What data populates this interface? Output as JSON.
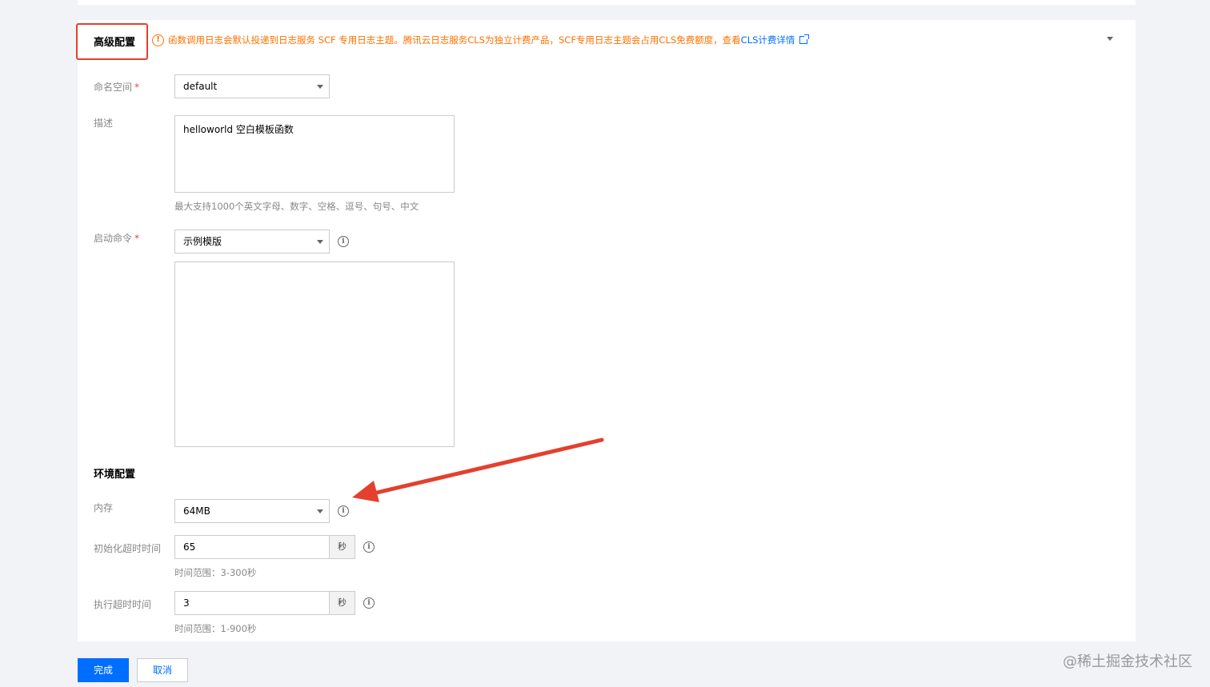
{
  "advanced": {
    "title": "高级配置",
    "notice_icon": "!",
    "notice_text": "函数调用日志会默认投递到日志服务 SCF 专用日志主题。腾讯云日志服务CLS为独立计费产品，SCF专用日志主题会占用CLS免费额度，查看",
    "notice_link": "CLS计费详情"
  },
  "namespace": {
    "label": "命名空间",
    "required": "*",
    "value": "default"
  },
  "description": {
    "label": "描述",
    "value": "helloworld 空白模板函数",
    "hint": "最大支持1000个英文字母、数字、空格、逗号、句号、中文"
  },
  "startup": {
    "label": "启动命令",
    "required": "*",
    "value": "示例模版",
    "script": ""
  },
  "env": {
    "title": "环境配置",
    "memory": {
      "label": "内存",
      "value": "64MB"
    },
    "init_timeout": {
      "label": "初始化超时时间",
      "value": "65",
      "unit": "秒",
      "hint": "时间范围：3-300秒"
    },
    "exec_timeout": {
      "label": "执行超时时间",
      "value": "3",
      "unit": "秒",
      "hint": "时间范围：1-900秒"
    }
  },
  "info_glyph": "i",
  "actions": {
    "confirm": "完成",
    "cancel": "取消"
  },
  "watermark": "@稀土掘金技术社区",
  "colors": {
    "primary": "#006eff",
    "warning": "#ff7200",
    "highlight": "#e3402e"
  }
}
